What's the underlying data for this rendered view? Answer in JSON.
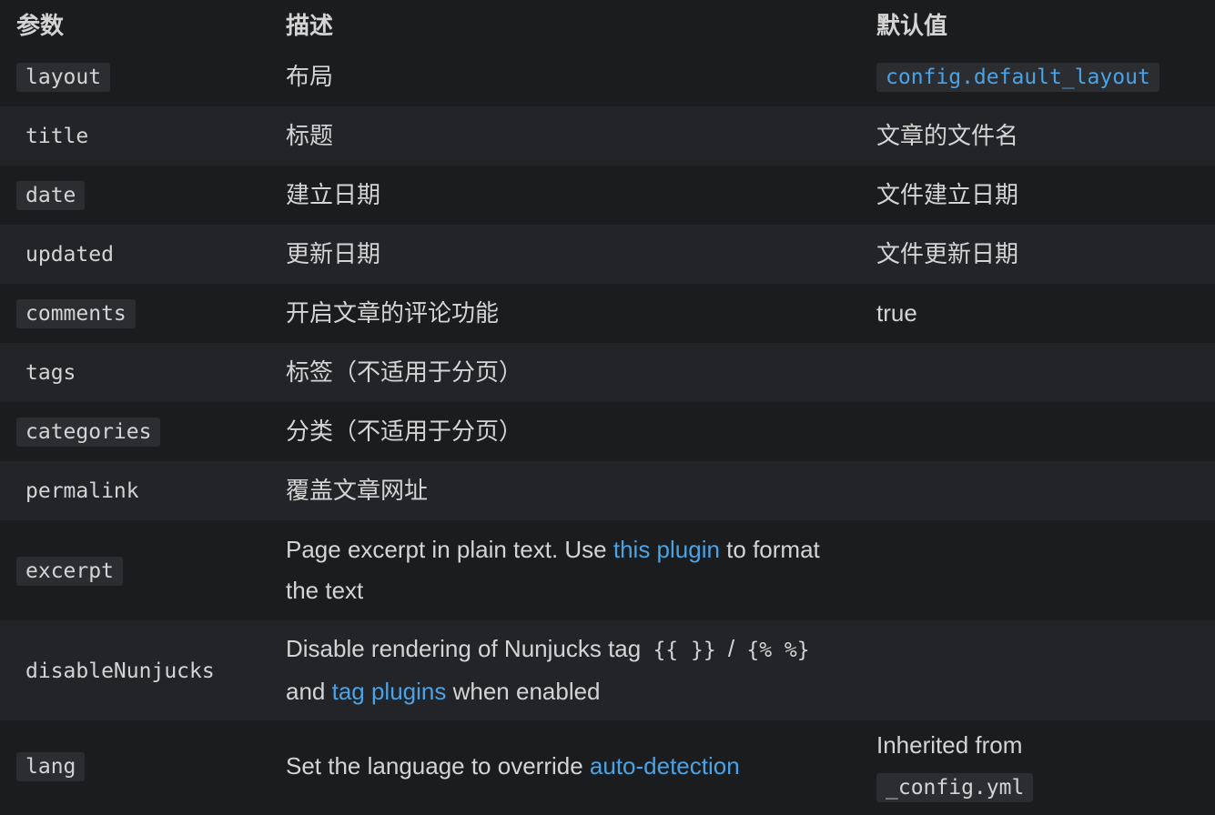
{
  "headers": {
    "param": "参数",
    "desc": "描述",
    "default": "默认值"
  },
  "rows": [
    {
      "param": "layout",
      "desc": "布局",
      "default": "config.default_layout"
    },
    {
      "param": "title",
      "desc": "标题",
      "default": "文章的文件名"
    },
    {
      "param": "date",
      "desc": "建立日期",
      "default": "文件建立日期"
    },
    {
      "param": "updated",
      "desc": "更新日期",
      "default": "文件更新日期"
    },
    {
      "param": "comments",
      "desc": "开启文章的评论功能",
      "default": "true"
    },
    {
      "param": "tags",
      "desc": "标签（不适用于分页）",
      "default": ""
    },
    {
      "param": "categories",
      "desc": "分类（不适用于分页）",
      "default": ""
    },
    {
      "param": "permalink",
      "desc": "覆盖文章网址",
      "default": ""
    },
    {
      "param": "excerpt",
      "desc_before": "Page excerpt in plain text. Use ",
      "desc_link": "this plugin",
      "desc_after": " to format the text",
      "default": ""
    },
    {
      "param": "disableNunjucks",
      "desc_before": "Disable rendering of Nunjucks tag ",
      "desc_code1": "{{ }}",
      "desc_sep": " / ",
      "desc_code2": "{% %}",
      "desc_mid": " and ",
      "desc_link": "tag plugins",
      "desc_after": " when enabled",
      "default": ""
    },
    {
      "param": "lang",
      "desc_before": "Set the language to override ",
      "desc_link": "auto-detection",
      "default_text": "Inherited from",
      "default_code": "_config.yml"
    }
  ]
}
